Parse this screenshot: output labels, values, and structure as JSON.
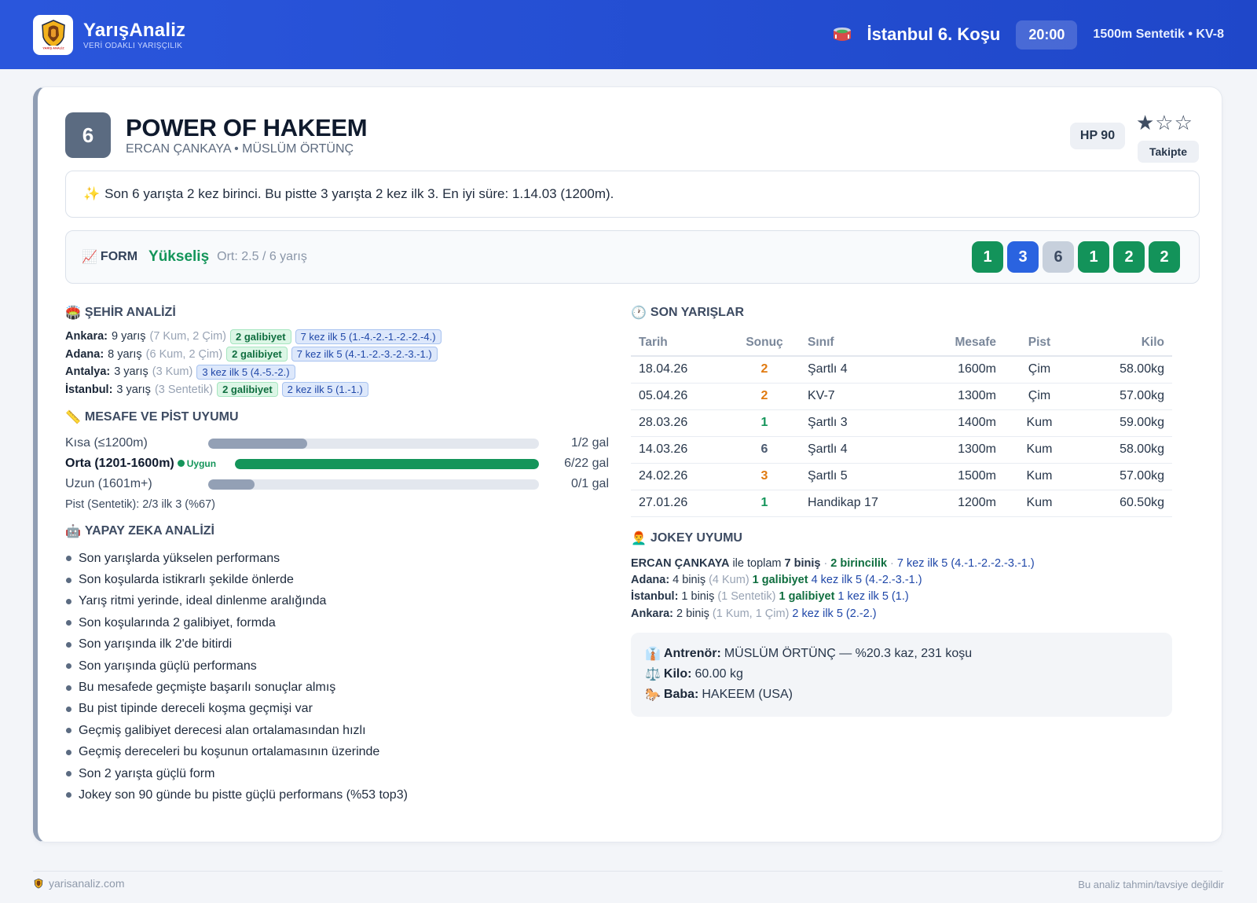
{
  "header": {
    "brand_title": "YarışAnaliz",
    "brand_subtitle": "VERİ ODAKLI YARIŞÇILIK",
    "logo_text": "YARIŞ ANALİZ",
    "race_title": "İstanbul 6. Koşu",
    "race_time": "20:00",
    "race_meta": "1500m Sentetik • KV-8"
  },
  "horse": {
    "number": "6",
    "name": "POWER OF HAKEEM",
    "people": "ERCAN ÇANKAYA • MÜSLÜM ÖRTÜNÇ",
    "hp": "HP 90",
    "stars": "★☆☆",
    "rating": "1 of 3 stars",
    "follow_label": "Takipte"
  },
  "summary": {
    "icon": "✨",
    "text": "Son 6 yarışta 2 kez birinci. Bu pistte 3 yarışta 2 kez ilk 3. En iyi süre: 1.14.03 (1200m)."
  },
  "form": {
    "icon": "📈",
    "label": "FORM",
    "trend": "Yükseliş",
    "average": "Ort: 2.5 / 6 yarış",
    "results": [
      {
        "value": "1",
        "color": "#13935a"
      },
      {
        "value": "3",
        "color": "#2a63e0"
      },
      {
        "value": "6",
        "color": "#c7d0dc",
        "text_color": "#3d4b62"
      },
      {
        "value": "1",
        "color": "#13935a"
      },
      {
        "value": "2",
        "color": "#13935a"
      },
      {
        "value": "2",
        "color": "#13935a"
      }
    ]
  },
  "city_analysis": {
    "icon": "🏟️",
    "title": "ŞEHİR ANALİZİ",
    "rows": [
      {
        "city": "Ankara:",
        "races": "9 yarış",
        "detail": "(7 Kum, 2 Çim)",
        "wins": "2 galibiyet",
        "top5": "7 kez ilk 5 (1.-4.-2.-1.-2.-2.-4.)"
      },
      {
        "city": "Adana:",
        "races": "8 yarış",
        "detail": "(6 Kum, 2 Çim)",
        "wins": "2 galibiyet",
        "top5": "7 kez ilk 5 (4.-1.-2.-3.-2.-3.-1.)"
      },
      {
        "city": "Antalya:",
        "races": "3 yarış",
        "detail": "(3 Kum)",
        "wins": "",
        "top5": "3 kez ilk 5 (4.-5.-2.)"
      },
      {
        "city": "İstanbul:",
        "races": "3 yarış",
        "detail": "(3 Sentetik)",
        "wins": "2 galibiyet",
        "top5": "2 kez ilk 5 (1.-1.)"
      }
    ]
  },
  "distance": {
    "icon": "📏",
    "title": "MESAFE VE PİST UYUMU",
    "rows": [
      {
        "name": "Kısa (≤1200m)",
        "fit": "",
        "value": "1/2 gal",
        "fill": 0.3,
        "color": "#93a0b5"
      },
      {
        "name": "Orta (1201-1600m)",
        "fit": "Uygun",
        "value": "6/22 gal",
        "fill": 1.0,
        "color": "#14955a"
      },
      {
        "name": "Uzun (1601m+)",
        "fit": "",
        "value": "0/1 gal",
        "fill": 0.14,
        "color": "#93a0b5"
      }
    ],
    "pist_text": "Pist (Sentetik): 2/3 ilk 3 (%67)"
  },
  "ai": {
    "icon": "🤖",
    "title": "YAPAY ZEKA ANALİZİ",
    "items": [
      "Son yarışlarda yükselen performans",
      "Son koşularda istikrarlı şekilde önlerde",
      "Yarış ritmi yerinde, ideal dinlenme aralığında",
      "Son koşularında 2 galibiyet, formda",
      "Son yarışında ilk 2'de bitirdi",
      "Son yarışında güçlü performans",
      "Bu mesafede geçmişte başarılı sonuçlar almış",
      "Bu pist tipinde dereceli koşma geçmişi var",
      "Geçmiş galibiyet derecesi alan ortalamasından hızlı",
      "Geçmiş dereceleri bu koşunun ortalamasının üzerinde",
      "Son 2 yarışta güçlü form",
      "Jokey son 90 günde bu pistte güçlü performans (%53 top3)"
    ]
  },
  "recent": {
    "icon": "🕐",
    "title": "SON YARIŞLAR",
    "headers": [
      "Tarih",
      "Sonuç",
      "Sınıf",
      "Mesafe",
      "Pist",
      "Kilo"
    ],
    "rows": [
      {
        "date": "18.04.26",
        "result": "2",
        "result_color": "#e07a10",
        "class": "Şartlı 4",
        "distance": "1600m",
        "track": "Çim",
        "weight": "58.00kg"
      },
      {
        "date": "05.04.26",
        "result": "2",
        "result_color": "#e07a10",
        "class": "KV-7",
        "distance": "1300m",
        "track": "Çim",
        "weight": "57.00kg"
      },
      {
        "date": "28.03.26",
        "result": "1",
        "result_color": "#14955a",
        "class": "Şartlı 3",
        "distance": "1400m",
        "track": "Kum",
        "weight": "59.00kg"
      },
      {
        "date": "14.03.26",
        "result": "6",
        "result_color": "#4b5a70",
        "class": "Şartlı 4",
        "distance": "1300m",
        "track": "Kum",
        "weight": "58.00kg"
      },
      {
        "date": "24.02.26",
        "result": "3",
        "result_color": "#e07a10",
        "class": "Şartlı 5",
        "distance": "1500m",
        "track": "Kum",
        "weight": "57.00kg"
      },
      {
        "date": "27.01.26",
        "result": "1",
        "result_color": "#14955a",
        "class": "Handikap 17",
        "distance": "1200m",
        "track": "Kum",
        "weight": "60.50kg"
      }
    ]
  },
  "jockey": {
    "icon": "👨‍🦰",
    "title": "JOKEY UYUMU",
    "name": "ERCAN ÇANKAYA",
    "total_prefix": "ile toplam",
    "total_rides": "7 biniş",
    "sep": "·",
    "wins": "2 birincilik",
    "top5": "7 kez ilk 5 (4.-1.-2.-2.-3.-1.)",
    "rows": [
      {
        "city": "Adana:",
        "rides": "4 biniş",
        "detail": "(4 Kum)",
        "wins": "1 galibiyet",
        "top5": "4 kez ilk 5 (4.-2.-3.-1.)"
      },
      {
        "city": "İstanbul:",
        "rides": "1 biniş",
        "detail": "(1 Sentetik)",
        "wins": "1 galibiyet",
        "top5": "1 kez ilk 5 (1.)"
      },
      {
        "city": "Ankara:",
        "rides": "2 biniş",
        "detail": "(1 Kum, 1 Çim)",
        "wins": "",
        "top5": "2 kez ilk 5 (2.-2.)"
      }
    ]
  },
  "info": {
    "trainer_icon": "👔",
    "trainer_label": "Antrenör:",
    "trainer_value": "MÜSLÜM ÖRTÜNÇ — %20.3 kaz, 231 koşu",
    "weight_icon": "⚖️",
    "weight_label": "Kilo:",
    "weight_value": "60.00 kg",
    "sire_icon": "🐎",
    "sire_label": "Baba:",
    "sire_value": "HAKEEM (USA)"
  },
  "footer": {
    "site": "yarisanaliz.com",
    "disclaimer": "Bu analiz tahmin/tavsiye değildir"
  }
}
